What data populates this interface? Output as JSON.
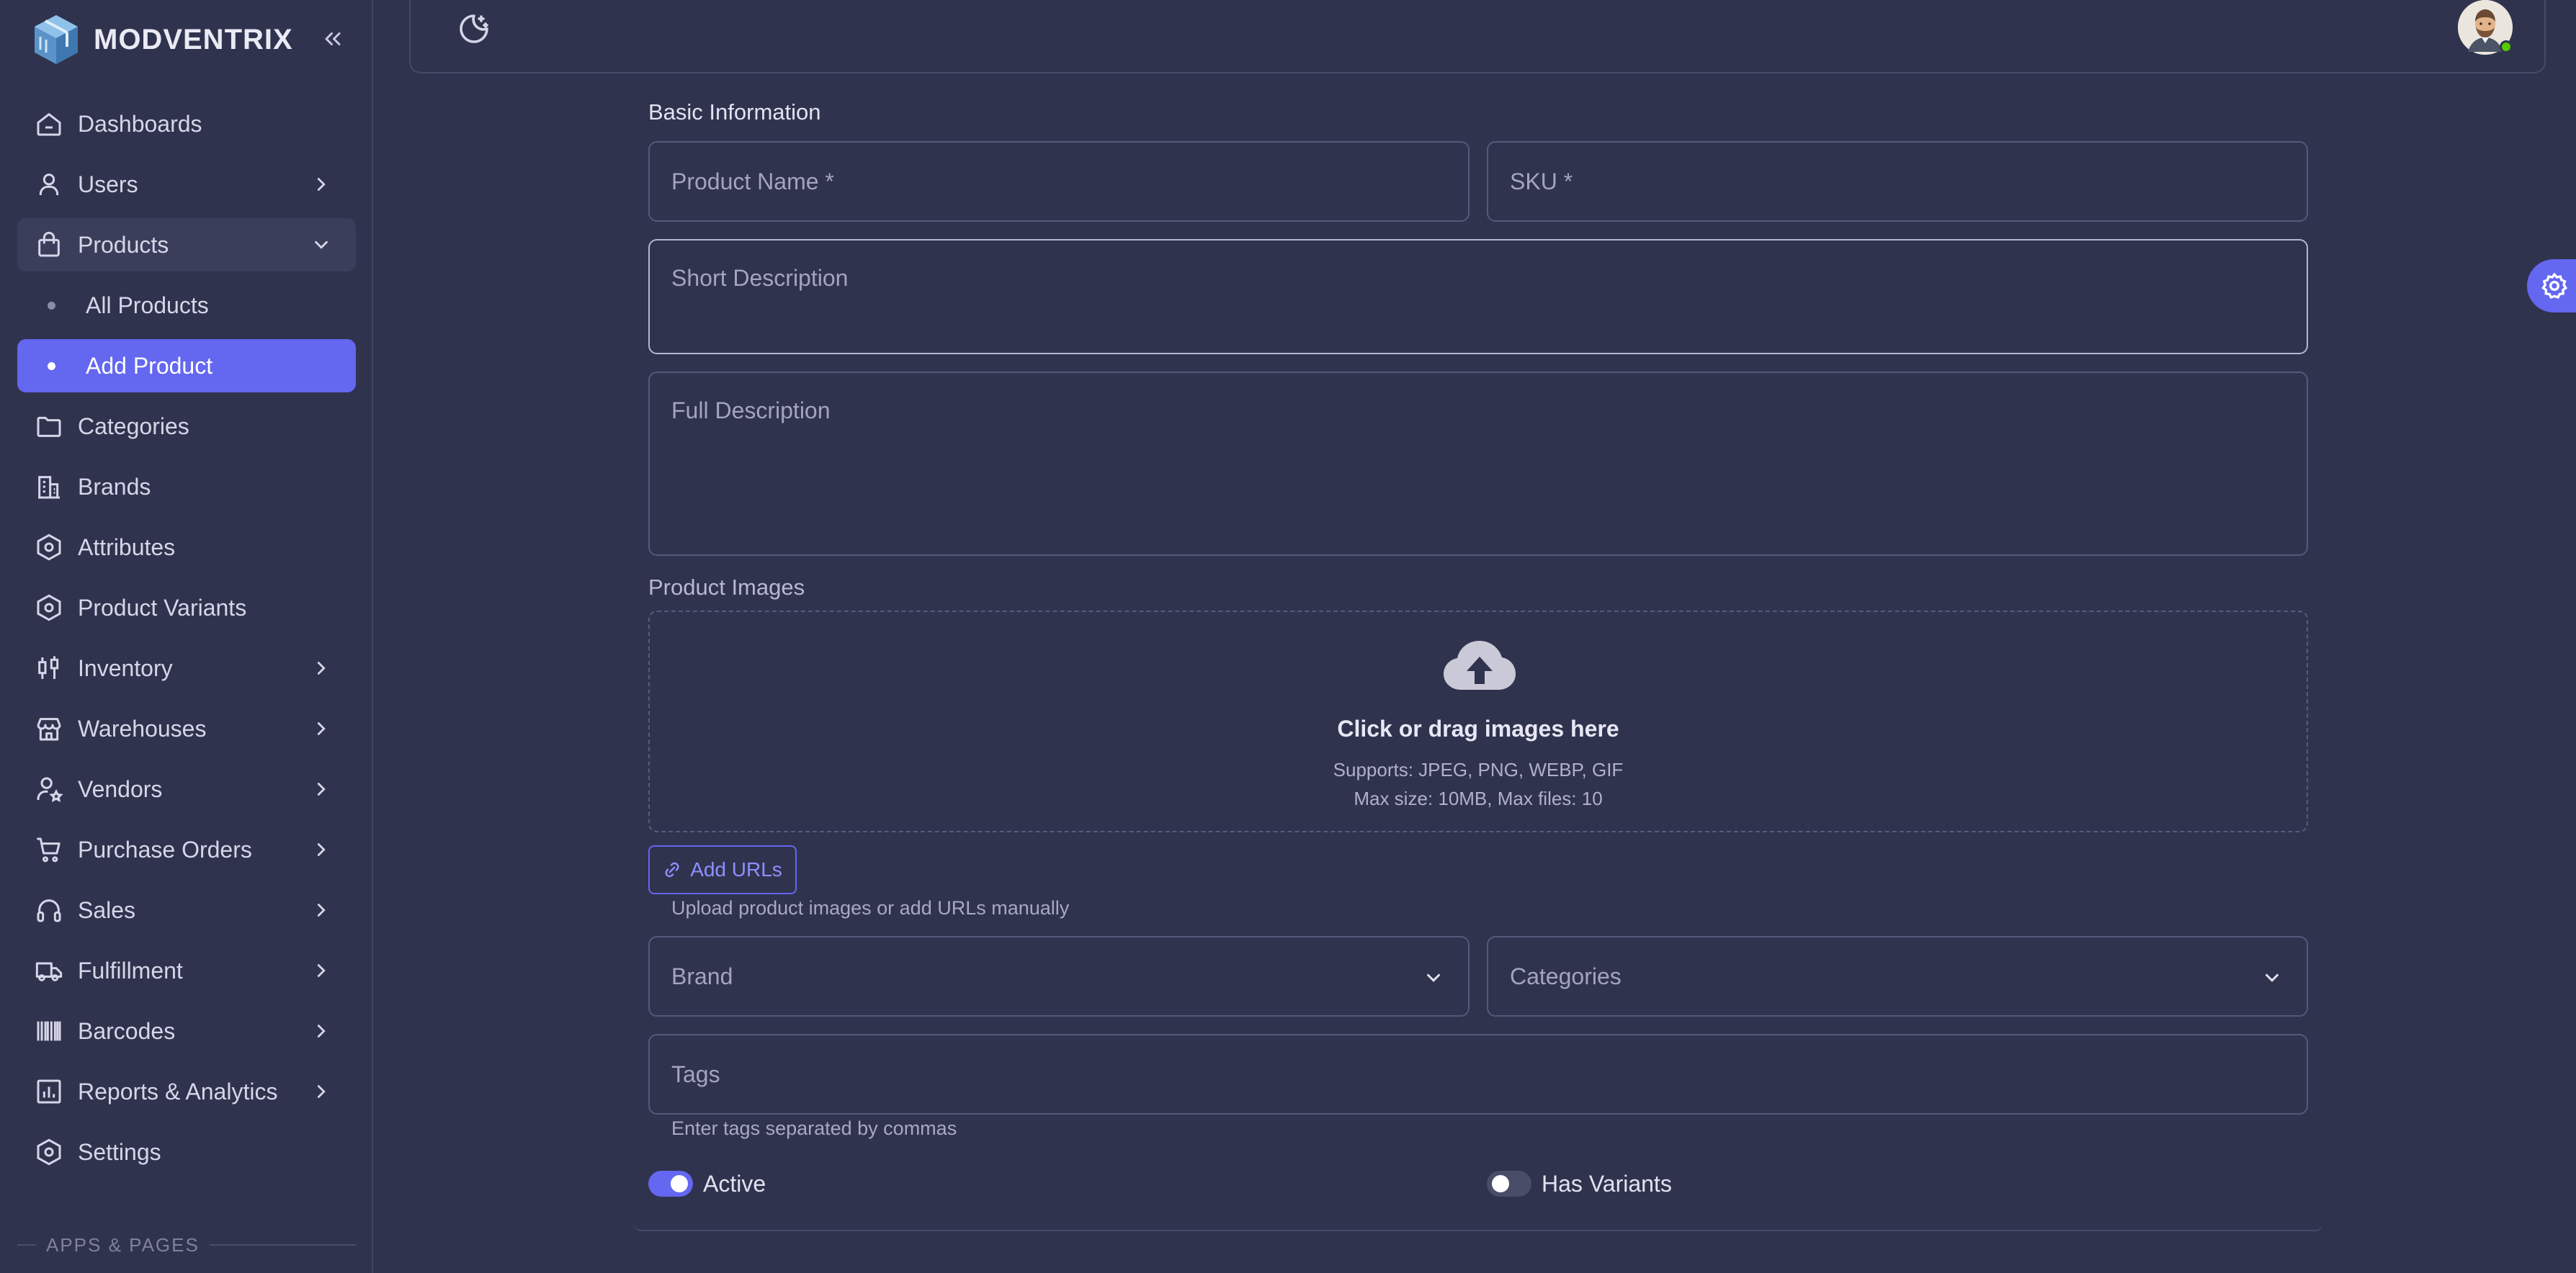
{
  "app": {
    "name": "MODVENTRIX"
  },
  "sidebar": {
    "items": [
      {
        "label": "Dashboards",
        "icon": "home-icon",
        "chevron": false
      },
      {
        "label": "Users",
        "icon": "user-icon",
        "chevron": true
      },
      {
        "label": "Products",
        "icon": "shopping-bag-icon",
        "chevron": true,
        "open": true
      },
      {
        "label": "All Products",
        "sub": true
      },
      {
        "label": "Add Product",
        "sub": true,
        "active": true
      },
      {
        "label": "Categories",
        "icon": "folder-icon",
        "chevron": false
      },
      {
        "label": "Brands",
        "icon": "building-icon",
        "chevron": false
      },
      {
        "label": "Attributes",
        "icon": "hexagon-icon",
        "chevron": false
      },
      {
        "label": "Product Variants",
        "icon": "hexagon-icon",
        "chevron": false
      },
      {
        "label": "Inventory",
        "icon": "candles-icon",
        "chevron": true
      },
      {
        "label": "Warehouses",
        "icon": "store-icon",
        "chevron": true
      },
      {
        "label": "Vendors",
        "icon": "user-star-icon",
        "chevron": true
      },
      {
        "label": "Purchase Orders",
        "icon": "cart-icon",
        "chevron": true
      },
      {
        "label": "Sales",
        "icon": "headphones-icon",
        "chevron": true
      },
      {
        "label": "Fulfillment",
        "icon": "truck-icon",
        "chevron": true
      },
      {
        "label": "Barcodes",
        "icon": "barcode-icon",
        "chevron": true
      },
      {
        "label": "Reports & Analytics",
        "icon": "chart-bar-icon",
        "chevron": true
      },
      {
        "label": "Settings",
        "icon": "settings-icon",
        "chevron": false
      }
    ],
    "section_label": "APPS & PAGES"
  },
  "form": {
    "section_title": "Basic Information",
    "product_name_placeholder": "Product Name *",
    "sku_placeholder": "SKU *",
    "short_description_placeholder": "Short Description",
    "full_description_placeholder": "Full Description",
    "images_label": "Product Images",
    "dropzone_title": "Click or drag images here",
    "dropzone_formats": "Supports: JPEG, PNG, WEBP, GIF",
    "dropzone_limits": "Max size: 10MB, Max files: 10",
    "add_urls_label": "Add URLs",
    "images_hint": "Upload product images or add URLs manually",
    "brand_placeholder": "Brand",
    "categories_placeholder": "Categories",
    "tags_placeholder": "Tags",
    "tags_hint": "Enter tags separated by commas",
    "active_label": "Active",
    "active_on": true,
    "variants_label": "Has Variants",
    "variants_on": false
  },
  "colors": {
    "background": "#30334e",
    "primary": "#6467f0",
    "border": "#55587a",
    "online": "#56ca00"
  }
}
